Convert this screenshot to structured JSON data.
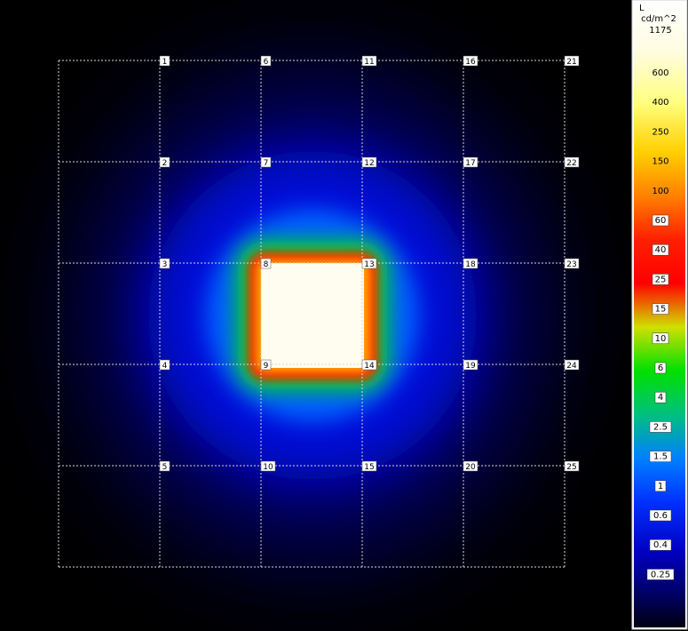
{
  "chart_data": {
    "type": "heatmap",
    "legend": {
      "unit_line1": "L",
      "unit_line2": "cd/m^2",
      "max": "1175",
      "ticks": [
        {
          "value": 600,
          "label": "600"
        },
        {
          "value": 400,
          "label": "400"
        },
        {
          "value": 250,
          "label": "250"
        },
        {
          "value": 150,
          "label": "150"
        },
        {
          "value": 100,
          "label": "100"
        },
        {
          "value": 60,
          "label": "60"
        },
        {
          "value": 40,
          "label": "40"
        },
        {
          "value": 25,
          "label": "25"
        },
        {
          "value": 15,
          "label": "15"
        },
        {
          "value": 10,
          "label": "10"
        },
        {
          "value": 6,
          "label": "6"
        },
        {
          "value": 4,
          "label": "4"
        },
        {
          "value": 2.5,
          "label": "2.5"
        },
        {
          "value": 1.5,
          "label": "1.5"
        },
        {
          "value": 1,
          "label": "1"
        },
        {
          "value": 0.6,
          "label": "0.6"
        },
        {
          "value": 0.4,
          "label": "0.4"
        },
        {
          "value": 0.25,
          "label": "0.25"
        }
      ]
    },
    "grid_points": [
      {
        "label": "1",
        "col": 1,
        "row": 0
      },
      {
        "label": "6",
        "col": 2,
        "row": 0
      },
      {
        "label": "11",
        "col": 3,
        "row": 0
      },
      {
        "label": "16",
        "col": 4,
        "row": 0
      },
      {
        "label": "21",
        "col": 5,
        "row": 0
      },
      {
        "label": "2",
        "col": 1,
        "row": 1
      },
      {
        "label": "7",
        "col": 2,
        "row": 1
      },
      {
        "label": "12",
        "col": 3,
        "row": 1
      },
      {
        "label": "17",
        "col": 4,
        "row": 1
      },
      {
        "label": "22",
        "col": 5,
        "row": 1
      },
      {
        "label": "3",
        "col": 1,
        "row": 2
      },
      {
        "label": "8",
        "col": 2,
        "row": 2
      },
      {
        "label": "13",
        "col": 3,
        "row": 2
      },
      {
        "label": "18",
        "col": 4,
        "row": 2
      },
      {
        "label": "23",
        "col": 5,
        "row": 2
      },
      {
        "label": "4",
        "col": 1,
        "row": 3
      },
      {
        "label": "9",
        "col": 2,
        "row": 3
      },
      {
        "label": "14",
        "col": 3,
        "row": 3
      },
      {
        "label": "19",
        "col": 4,
        "row": 3
      },
      {
        "label": "24",
        "col": 5,
        "row": 3
      },
      {
        "label": "5",
        "col": 1,
        "row": 4
      },
      {
        "label": "10",
        "col": 2,
        "row": 4
      },
      {
        "label": "15",
        "col": 3,
        "row": 4
      },
      {
        "label": "20",
        "col": 4,
        "row": 4
      },
      {
        "label": "25",
        "col": 5,
        "row": 4
      }
    ],
    "source_panel": {
      "col_from": 2,
      "col_to": 3,
      "row_from": 2,
      "row_to": 3,
      "luminance": 1175
    },
    "grid": {
      "cols": 5,
      "rows": 5
    }
  }
}
